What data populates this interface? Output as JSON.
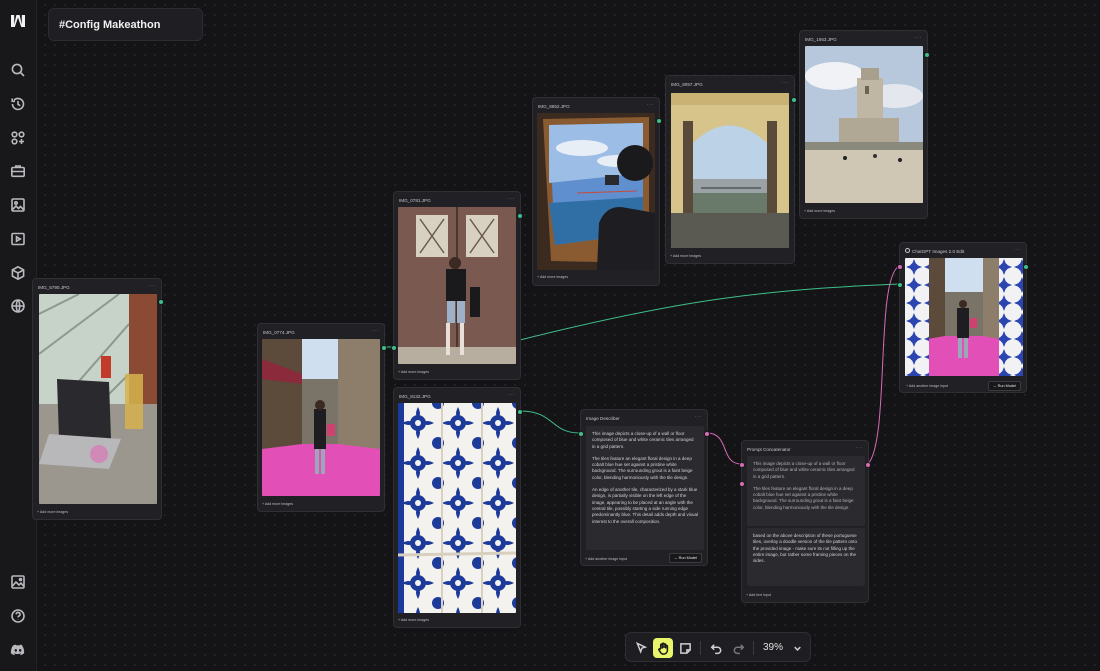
{
  "app": {
    "logo_icon": "logo-icon",
    "project_title": "#Config Makeathon"
  },
  "sidebar": {
    "items": [
      {
        "name": "search-icon"
      },
      {
        "name": "history-icon"
      },
      {
        "name": "shapes-add-icon"
      },
      {
        "name": "briefcase-icon"
      },
      {
        "name": "image-icon"
      },
      {
        "name": "video-icon"
      },
      {
        "name": "cube-icon"
      },
      {
        "name": "globe-icon"
      }
    ],
    "bottom_items": [
      {
        "name": "gallery-icon"
      },
      {
        "name": "help-icon"
      },
      {
        "name": "discord-icon"
      }
    ]
  },
  "nodes": {
    "img_5790": {
      "title": "IMG_5790.JPG",
      "add_label": "+ Add more images"
    },
    "img_0774": {
      "title": "IMG_0774.JPG",
      "add_label": "+ Add more images"
    },
    "img_0781": {
      "title": "IMG_0781.JPG",
      "add_label": "+ Add more images"
    },
    "img_8132": {
      "title": "IMG_8132.JPG",
      "add_label": "+ Add more images"
    },
    "img_8652": {
      "title": "IMG_8652.JPG",
      "add_label": "+ Add more images"
    },
    "img_8057": {
      "title": "IMG_8057.JPG",
      "add_label": "+ Add more images"
    },
    "img_1653": {
      "title": "IMG_1653.JPG",
      "add_label": "+ Add more images"
    },
    "describer": {
      "title": "Image Describer",
      "paragraphs": [
        "This image depicts a close-up of a wall or floor composed of blue and white ceramic tiles arranged in a grid pattern.",
        "The tiles feature an elegant floral design in a deep cobalt blue hue set against a pristine white background. The surrounding grout is a faint beige color, blending harmoniously with the tile design.",
        "An edge of another tile, characterized by a stark blue design, is partially visible on the left edge of the image, appearing to be placed at an angle with the central tile, possibly starting a side running edge predominantly blue. This detail adds depth and visual interest to the overall composition."
      ],
      "add_input_label": "+ Add another image input",
      "run_label": "→ Run Model"
    },
    "concatenator": {
      "title": "Prompt Concatenator",
      "paragraphs": [
        "This image depicts a close-up of a wall or floor composed of blue and white ceramic tiles arranged in a grid pattern.",
        "The tiles feature an elegant floral design in a deep cobalt blue hue set against a pristine white background. The surrounding grout is a faint beige color, blending harmoniously with the tile design."
      ],
      "prompt": "based on the above description of these portuguese tiles, overlay a doodle version of the tile pattern onto the provided image - make sure its not filling up the entire image, but rather some framing pieces on the sides.",
      "add_text_label": "+ Add text input"
    },
    "chatgpt": {
      "title": "ChatGPT Images 2.0 Edit",
      "add_input_label": "+ Add another image input",
      "run_label": "→ Run Model"
    }
  },
  "toolbar": {
    "tools": [
      {
        "name": "select-arrow-icon",
        "active": false
      },
      {
        "name": "hand-icon",
        "active": true
      },
      {
        "name": "sticky-note-icon",
        "active": false
      },
      {
        "name": "undo-icon",
        "active": false
      },
      {
        "name": "redo-icon",
        "active": false
      }
    ],
    "zoom": "39%",
    "zoom_dropdown_icon": "chevron-down-icon"
  },
  "colors": {
    "accent": "#e9f56a",
    "port_green": "#3fbf8a",
    "port_pink": "#d86bb4"
  }
}
